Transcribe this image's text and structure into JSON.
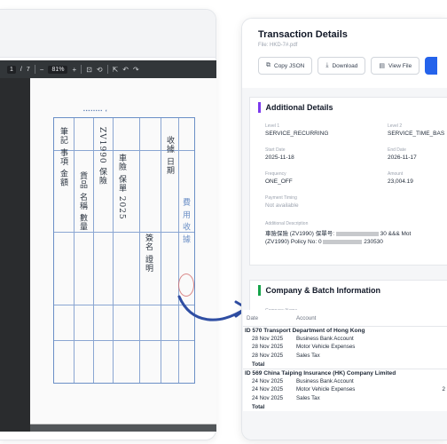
{
  "pdf_viewer": {
    "page_current": "1",
    "page_total": "7",
    "zoom": "81%",
    "toolbar_minus": "−",
    "toolbar_plus": "+"
  },
  "details": {
    "title": "Transaction Details",
    "file": "File: HKD-7#.pdf",
    "buttons": {
      "copy_json": "Copy JSON",
      "download": "Download",
      "view_file": "View File"
    },
    "additional": {
      "heading": "Additional Details",
      "level1_label": "Level 1",
      "level1_value": "SERVICE_RECURRING",
      "level2_label": "Level 2",
      "level2_value": "SERVICE_TIME_BAS",
      "start_label": "Start Date",
      "start_value": "2025-11-18",
      "end_label": "End Date",
      "end_value": "2026-11-17",
      "freq_label": "Frequency",
      "freq_value": "ONE_OFF",
      "amount_label": "Amount",
      "amount_value": "23,004.19",
      "timing_label": "Payment Timing",
      "timing_value": "Not available",
      "desc_label": "Additional Description",
      "desc_line1_a": "車險保險 (ZV1990) 保單号:",
      "desc_line1_b": "30 &&& Mot",
      "desc_line2_a": "(ZV1990) Policy No: 0",
      "desc_line2_b": "230530"
    },
    "company": {
      "heading": "Company & Batch Information",
      "name_label": "Company Name"
    }
  },
  "table": {
    "headers": [
      "Date",
      "Account"
    ],
    "groups": [
      {
        "title": "ID 570 Transport Department of Hong Kong",
        "rows": [
          {
            "date": "28 Nov 2025",
            "account": "Business Bank Account",
            "extra": ""
          },
          {
            "date": "28 Nov 2025",
            "account": "Motor Vehicle Expenses",
            "extra": ""
          },
          {
            "date": "28 Nov 2025",
            "account": "Sales Tax",
            "extra": ""
          }
        ],
        "total": "Total"
      },
      {
        "title": "ID 569 China Taiping Insurance (HK) Company Limited",
        "rows": [
          {
            "date": "24 Nov 2025",
            "account": "Business Bank Account",
            "extra": ""
          },
          {
            "date": "24 Nov 2025",
            "account": "Motor Vehicle Expenses",
            "extra": "2"
          },
          {
            "date": "24 Nov 2025",
            "account": "Sales Tax",
            "extra": ""
          }
        ],
        "total": "Total"
      }
    ]
  },
  "colors": {
    "accent_blue": "#2563eb",
    "section_purple": "#7c3aed",
    "section_green": "#16a34a",
    "arrow": "#2f4ea3",
    "stamp": "#d26b6b"
  }
}
